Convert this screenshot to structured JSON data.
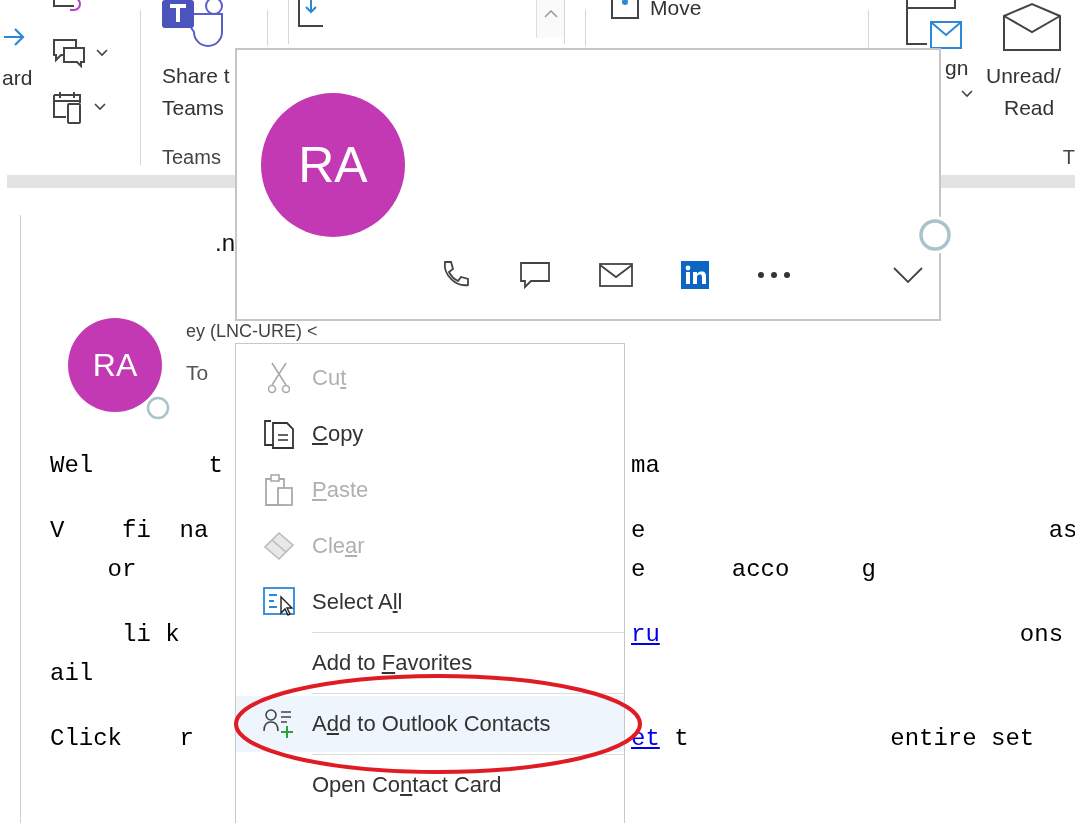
{
  "ribbon": {
    "forward_label": "ard",
    "share_label": "Share t",
    "share_label_2": "Teams",
    "teams_group": "Teams",
    "move_label": "Move",
    "assign_label": "gn",
    "unread_label": "Unread/",
    "unread_label_2": "Read",
    "tags_group": "T"
  },
  "contact_card": {
    "initials": "RA",
    "available": false
  },
  "message": {
    "subject": ".n",
    "sender": "ey (LNC-URE) <",
    "initials": "RA",
    "available": false,
    "to_label": "To",
    "paragraphs": [
      {
        "lines": [
          {
            "left": "Wel        t",
            "right": [
              {
                "text": "ma",
                "link": false
              }
            ]
          }
        ]
      },
      {
        "lines": [
          {
            "left": "V    fi  na",
            "right": [
              {
                "text": "e                            as",
                "link": false
              }
            ]
          },
          {
            "left": "    or",
            "right": [
              {
                "text": "e      acco     g",
                "link": false
              }
            ]
          }
        ]
      },
      {
        "lines": [
          {
            "left": "     li k",
            "right": [
              {
                "text": "ru",
                "link": true
              },
              {
                "text": "                         ons",
                "link": false
              }
            ]
          },
          {
            "left": "ail"
          }
        ]
      },
      {
        "lines": [
          {
            "left": "Click    r",
            "right": [
              {
                "text": "et",
                "link": true
              },
              {
                "text": " t              entire set",
                "link": false
              }
            ]
          }
        ]
      }
    ]
  },
  "context_menu": {
    "items": [
      {
        "kind": "command",
        "pre": "Cu",
        "key": "t",
        "disabled": true,
        "selected": false,
        "circled": false
      },
      {
        "kind": "command",
        "key": "C",
        "post": "opy",
        "disabled": false,
        "selected": false,
        "circled": false
      },
      {
        "kind": "command",
        "key": "P",
        "post": "aste",
        "disabled": true,
        "selected": false,
        "circled": false
      },
      {
        "kind": "command",
        "pre": "Cle",
        "key": "a",
        "post": "r",
        "disabled": true,
        "selected": false,
        "circled": false
      },
      {
        "kind": "command",
        "pre": "Select A",
        "key": "l",
        "post": "l",
        "disabled": false,
        "selected": false,
        "circled": false
      },
      {
        "kind": "separator"
      },
      {
        "kind": "command",
        "pre": "Add to ",
        "key": "F",
        "post": "avorites",
        "disabled": false,
        "selected": false,
        "circled": false
      },
      {
        "kind": "separator"
      },
      {
        "kind": "command",
        "pre": "A",
        "key": "d",
        "post": "d to Outlook Contacts",
        "disabled": false,
        "selected": true,
        "circled": true
      },
      {
        "kind": "separator"
      },
      {
        "kind": "command",
        "pre": "Open Co",
        "key": "n",
        "post": "tact Card",
        "disabled": false,
        "selected": false,
        "circled": false
      }
    ]
  }
}
